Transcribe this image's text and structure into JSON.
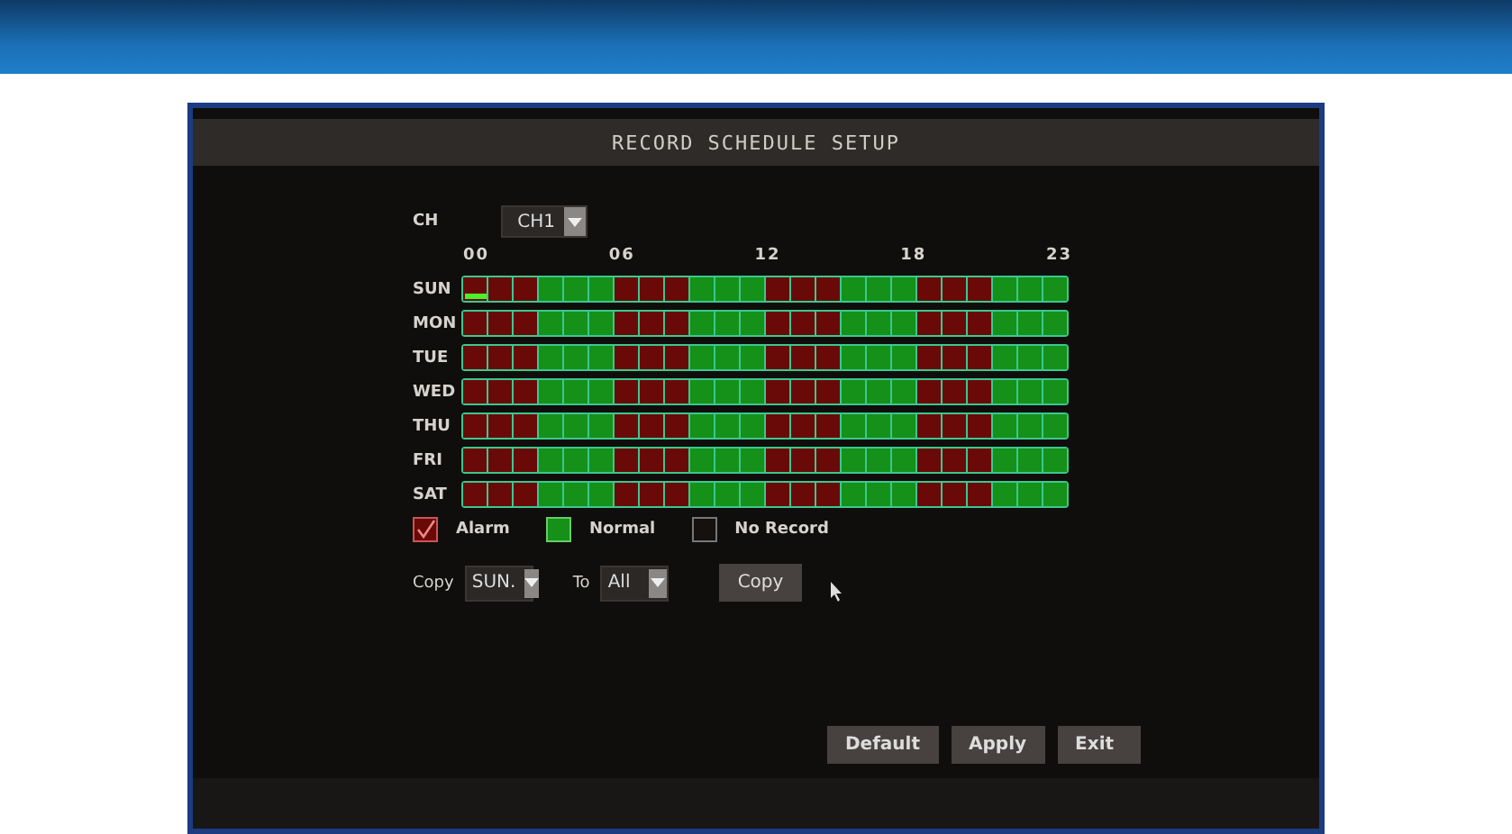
{
  "window": {
    "title": "RECORD SCHEDULE SETUP"
  },
  "channel": {
    "label": "CH",
    "value": "CH1"
  },
  "hour_labels": [
    "00",
    "06",
    "12",
    "18",
    "23"
  ],
  "schedule": [
    {
      "day": "SUN",
      "cursor": true,
      "hours": [
        {
          "kind": "alarm"
        },
        {
          "kind": "alarm"
        },
        {
          "kind": "alarm"
        },
        {
          "kind": "normal"
        },
        {
          "kind": "normal"
        },
        {
          "kind": "normal"
        },
        {
          "kind": "alarm"
        },
        {
          "kind": "alarm"
        },
        {
          "kind": "alarm"
        },
        {
          "kind": "normal"
        },
        {
          "kind": "normal"
        },
        {
          "kind": "normal"
        },
        {
          "kind": "alarm"
        },
        {
          "kind": "alarm"
        },
        {
          "kind": "alarm"
        },
        {
          "kind": "normal"
        },
        {
          "kind": "normal"
        },
        {
          "kind": "normal"
        },
        {
          "kind": "alarm"
        },
        {
          "kind": "alarm"
        },
        {
          "kind": "alarm"
        },
        {
          "kind": "normal"
        },
        {
          "kind": "normal"
        },
        {
          "kind": "normal"
        }
      ]
    },
    {
      "day": "MON",
      "cursor": false,
      "hours": [
        {
          "kind": "alarm"
        },
        {
          "kind": "alarm"
        },
        {
          "kind": "alarm"
        },
        {
          "kind": "normal"
        },
        {
          "kind": "normal"
        },
        {
          "kind": "normal"
        },
        {
          "kind": "alarm"
        },
        {
          "kind": "alarm"
        },
        {
          "kind": "alarm"
        },
        {
          "kind": "normal"
        },
        {
          "kind": "normal"
        },
        {
          "kind": "normal"
        },
        {
          "kind": "alarm"
        },
        {
          "kind": "alarm"
        },
        {
          "kind": "alarm"
        },
        {
          "kind": "normal"
        },
        {
          "kind": "normal"
        },
        {
          "kind": "normal"
        },
        {
          "kind": "alarm"
        },
        {
          "kind": "alarm"
        },
        {
          "kind": "alarm"
        },
        {
          "kind": "normal"
        },
        {
          "kind": "normal"
        },
        {
          "kind": "normal"
        }
      ]
    },
    {
      "day": "TUE",
      "cursor": false,
      "hours": [
        {
          "kind": "alarm"
        },
        {
          "kind": "alarm"
        },
        {
          "kind": "alarm"
        },
        {
          "kind": "normal"
        },
        {
          "kind": "normal"
        },
        {
          "kind": "normal"
        },
        {
          "kind": "alarm"
        },
        {
          "kind": "alarm"
        },
        {
          "kind": "alarm"
        },
        {
          "kind": "normal"
        },
        {
          "kind": "normal"
        },
        {
          "kind": "normal"
        },
        {
          "kind": "alarm"
        },
        {
          "kind": "alarm"
        },
        {
          "kind": "alarm"
        },
        {
          "kind": "normal"
        },
        {
          "kind": "normal"
        },
        {
          "kind": "normal"
        },
        {
          "kind": "alarm"
        },
        {
          "kind": "alarm"
        },
        {
          "kind": "alarm"
        },
        {
          "kind": "normal"
        },
        {
          "kind": "normal"
        },
        {
          "kind": "normal"
        }
      ]
    },
    {
      "day": "WED",
      "cursor": false,
      "hours": [
        {
          "kind": "alarm"
        },
        {
          "kind": "alarm"
        },
        {
          "kind": "alarm"
        },
        {
          "kind": "normal"
        },
        {
          "kind": "normal"
        },
        {
          "kind": "normal"
        },
        {
          "kind": "alarm"
        },
        {
          "kind": "alarm"
        },
        {
          "kind": "alarm"
        },
        {
          "kind": "normal"
        },
        {
          "kind": "normal"
        },
        {
          "kind": "normal"
        },
        {
          "kind": "alarm"
        },
        {
          "kind": "alarm"
        },
        {
          "kind": "alarm"
        },
        {
          "kind": "normal"
        },
        {
          "kind": "normal"
        },
        {
          "kind": "normal"
        },
        {
          "kind": "alarm"
        },
        {
          "kind": "alarm"
        },
        {
          "kind": "alarm"
        },
        {
          "kind": "normal"
        },
        {
          "kind": "normal"
        },
        {
          "kind": "normal"
        }
      ]
    },
    {
      "day": "THU",
      "cursor": false,
      "hours": [
        {
          "kind": "alarm"
        },
        {
          "kind": "alarm"
        },
        {
          "kind": "alarm"
        },
        {
          "kind": "normal"
        },
        {
          "kind": "normal"
        },
        {
          "kind": "normal"
        },
        {
          "kind": "alarm"
        },
        {
          "kind": "alarm"
        },
        {
          "kind": "alarm"
        },
        {
          "kind": "normal"
        },
        {
          "kind": "normal"
        },
        {
          "kind": "normal"
        },
        {
          "kind": "alarm"
        },
        {
          "kind": "alarm"
        },
        {
          "kind": "alarm"
        },
        {
          "kind": "normal"
        },
        {
          "kind": "normal"
        },
        {
          "kind": "normal"
        },
        {
          "kind": "alarm"
        },
        {
          "kind": "alarm"
        },
        {
          "kind": "alarm"
        },
        {
          "kind": "normal"
        },
        {
          "kind": "normal"
        },
        {
          "kind": "normal"
        }
      ]
    },
    {
      "day": "FRI",
      "cursor": false,
      "hours": [
        {
          "kind": "alarm"
        },
        {
          "kind": "alarm"
        },
        {
          "kind": "alarm"
        },
        {
          "kind": "normal"
        },
        {
          "kind": "normal"
        },
        {
          "kind": "normal"
        },
        {
          "kind": "alarm"
        },
        {
          "kind": "alarm"
        },
        {
          "kind": "alarm"
        },
        {
          "kind": "normal"
        },
        {
          "kind": "normal"
        },
        {
          "kind": "normal"
        },
        {
          "kind": "alarm"
        },
        {
          "kind": "alarm"
        },
        {
          "kind": "alarm"
        },
        {
          "kind": "normal"
        },
        {
          "kind": "normal"
        },
        {
          "kind": "normal"
        },
        {
          "kind": "alarm"
        },
        {
          "kind": "alarm"
        },
        {
          "kind": "alarm"
        },
        {
          "kind": "normal"
        },
        {
          "kind": "normal"
        },
        {
          "kind": "normal"
        }
      ]
    },
    {
      "day": "SAT",
      "cursor": false,
      "hours": [
        {
          "kind": "alarm"
        },
        {
          "kind": "alarm"
        },
        {
          "kind": "alarm"
        },
        {
          "kind": "normal"
        },
        {
          "kind": "normal"
        },
        {
          "kind": "normal"
        },
        {
          "kind": "alarm"
        },
        {
          "kind": "alarm"
        },
        {
          "kind": "alarm"
        },
        {
          "kind": "normal"
        },
        {
          "kind": "normal"
        },
        {
          "kind": "normal"
        },
        {
          "kind": "alarm"
        },
        {
          "kind": "alarm"
        },
        {
          "kind": "alarm"
        },
        {
          "kind": "normal"
        },
        {
          "kind": "normal"
        },
        {
          "kind": "normal"
        },
        {
          "kind": "alarm"
        },
        {
          "kind": "alarm"
        },
        {
          "kind": "alarm"
        },
        {
          "kind": "normal"
        },
        {
          "kind": "normal"
        },
        {
          "kind": "normal"
        }
      ]
    }
  ],
  "legend": [
    {
      "kind": "alarm",
      "label": "Alarm",
      "selected": true
    },
    {
      "kind": "normal",
      "label": "Normal",
      "selected": false
    },
    {
      "kind": "none",
      "label": "No Record",
      "selected": false
    }
  ],
  "copy": {
    "label": "Copy",
    "from": "SUN.",
    "to_label": "To",
    "to": "All",
    "button": "Copy"
  },
  "buttons": [
    "Default",
    "Apply",
    "Exit"
  ]
}
